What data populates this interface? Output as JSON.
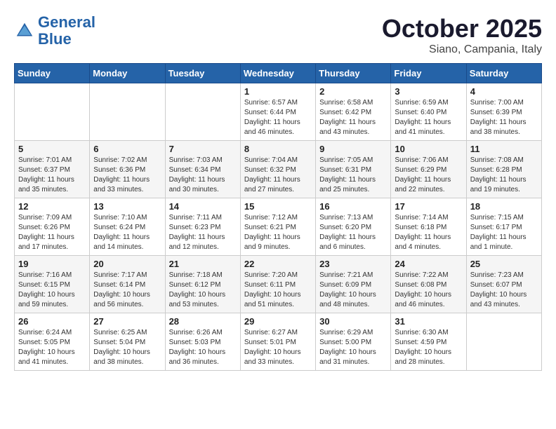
{
  "header": {
    "logo_line1": "General",
    "logo_line2": "Blue",
    "title": "October 2025",
    "subtitle": "Siano, Campania, Italy"
  },
  "weekdays": [
    "Sunday",
    "Monday",
    "Tuesday",
    "Wednesday",
    "Thursday",
    "Friday",
    "Saturday"
  ],
  "weeks": [
    [
      {
        "day": "",
        "info": ""
      },
      {
        "day": "",
        "info": ""
      },
      {
        "day": "",
        "info": ""
      },
      {
        "day": "1",
        "info": "Sunrise: 6:57 AM\nSunset: 6:44 PM\nDaylight: 11 hours\nand 46 minutes."
      },
      {
        "day": "2",
        "info": "Sunrise: 6:58 AM\nSunset: 6:42 PM\nDaylight: 11 hours\nand 43 minutes."
      },
      {
        "day": "3",
        "info": "Sunrise: 6:59 AM\nSunset: 6:40 PM\nDaylight: 11 hours\nand 41 minutes."
      },
      {
        "day": "4",
        "info": "Sunrise: 7:00 AM\nSunset: 6:39 PM\nDaylight: 11 hours\nand 38 minutes."
      }
    ],
    [
      {
        "day": "5",
        "info": "Sunrise: 7:01 AM\nSunset: 6:37 PM\nDaylight: 11 hours\nand 35 minutes."
      },
      {
        "day": "6",
        "info": "Sunrise: 7:02 AM\nSunset: 6:36 PM\nDaylight: 11 hours\nand 33 minutes."
      },
      {
        "day": "7",
        "info": "Sunrise: 7:03 AM\nSunset: 6:34 PM\nDaylight: 11 hours\nand 30 minutes."
      },
      {
        "day": "8",
        "info": "Sunrise: 7:04 AM\nSunset: 6:32 PM\nDaylight: 11 hours\nand 27 minutes."
      },
      {
        "day": "9",
        "info": "Sunrise: 7:05 AM\nSunset: 6:31 PM\nDaylight: 11 hours\nand 25 minutes."
      },
      {
        "day": "10",
        "info": "Sunrise: 7:06 AM\nSunset: 6:29 PM\nDaylight: 11 hours\nand 22 minutes."
      },
      {
        "day": "11",
        "info": "Sunrise: 7:08 AM\nSunset: 6:28 PM\nDaylight: 11 hours\nand 19 minutes."
      }
    ],
    [
      {
        "day": "12",
        "info": "Sunrise: 7:09 AM\nSunset: 6:26 PM\nDaylight: 11 hours\nand 17 minutes."
      },
      {
        "day": "13",
        "info": "Sunrise: 7:10 AM\nSunset: 6:24 PM\nDaylight: 11 hours\nand 14 minutes."
      },
      {
        "day": "14",
        "info": "Sunrise: 7:11 AM\nSunset: 6:23 PM\nDaylight: 11 hours\nand 12 minutes."
      },
      {
        "day": "15",
        "info": "Sunrise: 7:12 AM\nSunset: 6:21 PM\nDaylight: 11 hours\nand 9 minutes."
      },
      {
        "day": "16",
        "info": "Sunrise: 7:13 AM\nSunset: 6:20 PM\nDaylight: 11 hours\nand 6 minutes."
      },
      {
        "day": "17",
        "info": "Sunrise: 7:14 AM\nSunset: 6:18 PM\nDaylight: 11 hours\nand 4 minutes."
      },
      {
        "day": "18",
        "info": "Sunrise: 7:15 AM\nSunset: 6:17 PM\nDaylight: 11 hours\nand 1 minute."
      }
    ],
    [
      {
        "day": "19",
        "info": "Sunrise: 7:16 AM\nSunset: 6:15 PM\nDaylight: 10 hours\nand 59 minutes."
      },
      {
        "day": "20",
        "info": "Sunrise: 7:17 AM\nSunset: 6:14 PM\nDaylight: 10 hours\nand 56 minutes."
      },
      {
        "day": "21",
        "info": "Sunrise: 7:18 AM\nSunset: 6:12 PM\nDaylight: 10 hours\nand 53 minutes."
      },
      {
        "day": "22",
        "info": "Sunrise: 7:20 AM\nSunset: 6:11 PM\nDaylight: 10 hours\nand 51 minutes."
      },
      {
        "day": "23",
        "info": "Sunrise: 7:21 AM\nSunset: 6:09 PM\nDaylight: 10 hours\nand 48 minutes."
      },
      {
        "day": "24",
        "info": "Sunrise: 7:22 AM\nSunset: 6:08 PM\nDaylight: 10 hours\nand 46 minutes."
      },
      {
        "day": "25",
        "info": "Sunrise: 7:23 AM\nSunset: 6:07 PM\nDaylight: 10 hours\nand 43 minutes."
      }
    ],
    [
      {
        "day": "26",
        "info": "Sunrise: 6:24 AM\nSunset: 5:05 PM\nDaylight: 10 hours\nand 41 minutes."
      },
      {
        "day": "27",
        "info": "Sunrise: 6:25 AM\nSunset: 5:04 PM\nDaylight: 10 hours\nand 38 minutes."
      },
      {
        "day": "28",
        "info": "Sunrise: 6:26 AM\nSunset: 5:03 PM\nDaylight: 10 hours\nand 36 minutes."
      },
      {
        "day": "29",
        "info": "Sunrise: 6:27 AM\nSunset: 5:01 PM\nDaylight: 10 hours\nand 33 minutes."
      },
      {
        "day": "30",
        "info": "Sunrise: 6:29 AM\nSunset: 5:00 PM\nDaylight: 10 hours\nand 31 minutes."
      },
      {
        "day": "31",
        "info": "Sunrise: 6:30 AM\nSunset: 4:59 PM\nDaylight: 10 hours\nand 28 minutes."
      },
      {
        "day": "",
        "info": ""
      }
    ]
  ]
}
